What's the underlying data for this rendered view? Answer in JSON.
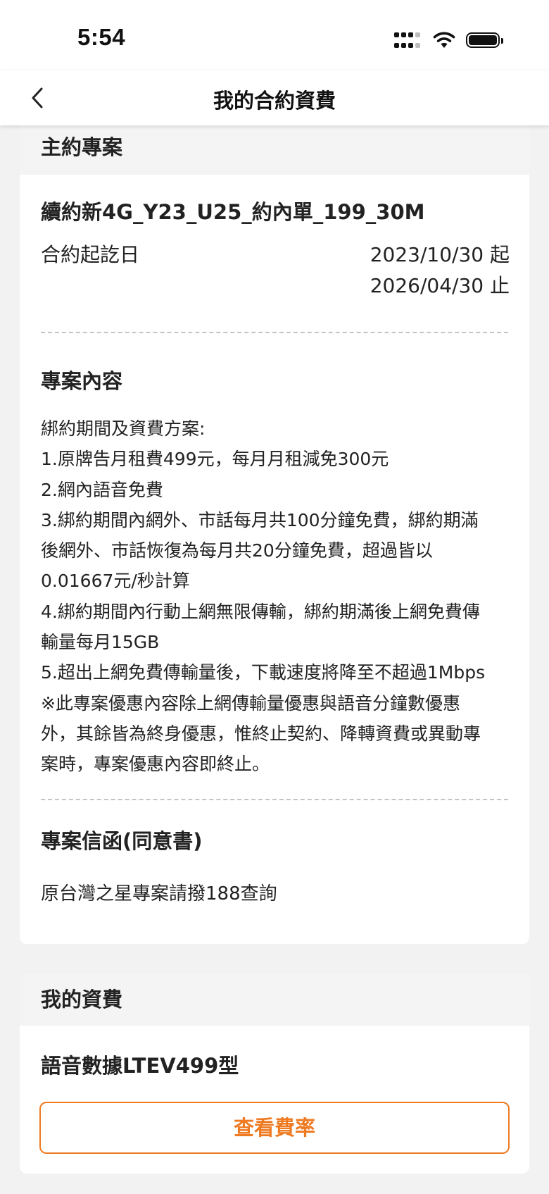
{
  "status_bar": {
    "time": "5:54"
  },
  "nav": {
    "title": "我的合約資費"
  },
  "main_contract": {
    "header": "主約專案",
    "plan_name": "續約新4G_Y23_U25_約內單_199_30M",
    "period_label": "合約起訖日",
    "start_date": "2023/10/30 起",
    "end_date": "2026/04/30 止",
    "content_title": "專案內容",
    "content_lines": [
      "綁約期間及資費方案:",
      "1.原牌告月租費499元，每月月租減免300元",
      "2.網內語音免費",
      "3.綁約期間內網外、市話每月共100分鐘免費，綁約期滿",
      "後網外、市話恢復為每月共20分鐘免費，超過皆以",
      "0.01667元/秒計算",
      "4.綁約期間內行動上網無限傳輸，綁約期滿後上網免費傳",
      "輸量每月15GB",
      "5.超出上網免費傳輸量後，下載速度將降至不超過1Mbps",
      "※此專案優惠內容除上網傳輸量優惠與語音分鐘數優惠",
      "外，其餘皆為終身優惠，惟終止契約、降轉資費或異動專",
      "案時，專案優惠內容即終止。"
    ],
    "letter_title": "專案信函(同意書)",
    "letter_text": "原台灣之星專案請撥188查詢"
  },
  "my_rate": {
    "header": "我的資費",
    "plan_name": "語音數據LTEV499型",
    "view_rates_label": "查看費率"
  },
  "colors": {
    "accent": "#ee7a22",
    "background": "#f2f2f2",
    "card_header": "#f4f4f4"
  }
}
